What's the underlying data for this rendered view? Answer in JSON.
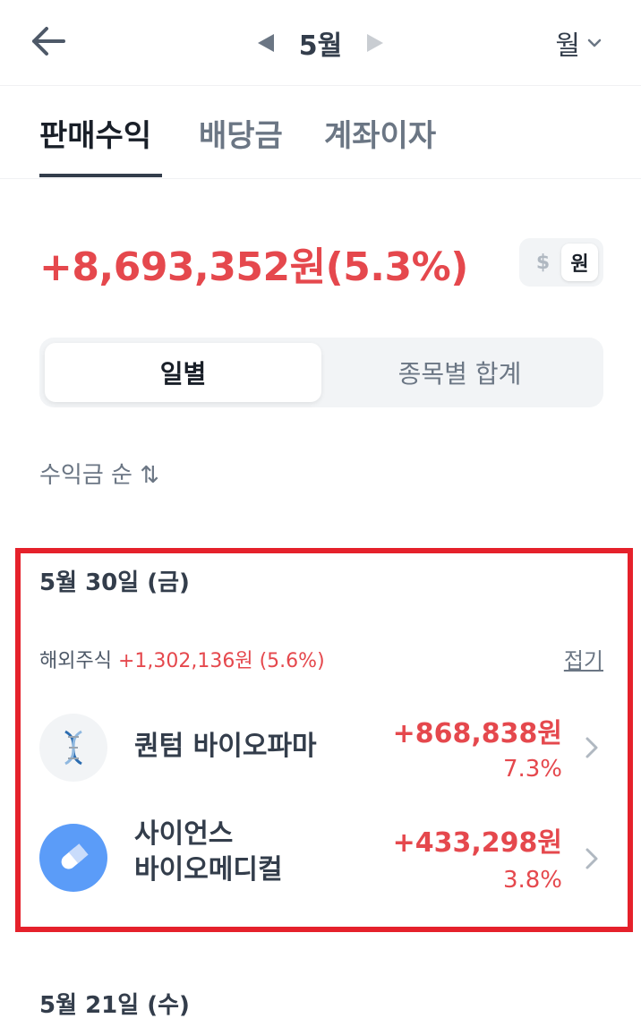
{
  "header": {
    "month": "5월",
    "period": "월"
  },
  "tabs": [
    {
      "label": "판매수익"
    },
    {
      "label": "배당금"
    },
    {
      "label": "계좌이자"
    }
  ],
  "summary": {
    "total": "+8,693,352원(5.3%)"
  },
  "currency_toggle": {
    "usd": "$",
    "krw": "원"
  },
  "segment": {
    "daily": "일별",
    "by_stock": "종목별 합계"
  },
  "sort": {
    "label": "수익금 순 ⇅"
  },
  "days": [
    {
      "date": "5월 30일 (금)",
      "group": {
        "name": "해외주식",
        "gain": "+1,302,136원 (5.6%)",
        "collapse": "접기"
      },
      "stocks": [
        {
          "name": "퀀텀 바이오파마",
          "amount": "+868,838원",
          "percent": "7.3%"
        },
        {
          "name_line1": "사이언스",
          "name_line2": "바이오메디컬",
          "amount": "+433,298원",
          "percent": "3.8%"
        }
      ]
    },
    {
      "date": "5월 21일 (수)"
    }
  ],
  "colors": {
    "gain": "#e5484d",
    "highlight": "#e5212b"
  }
}
